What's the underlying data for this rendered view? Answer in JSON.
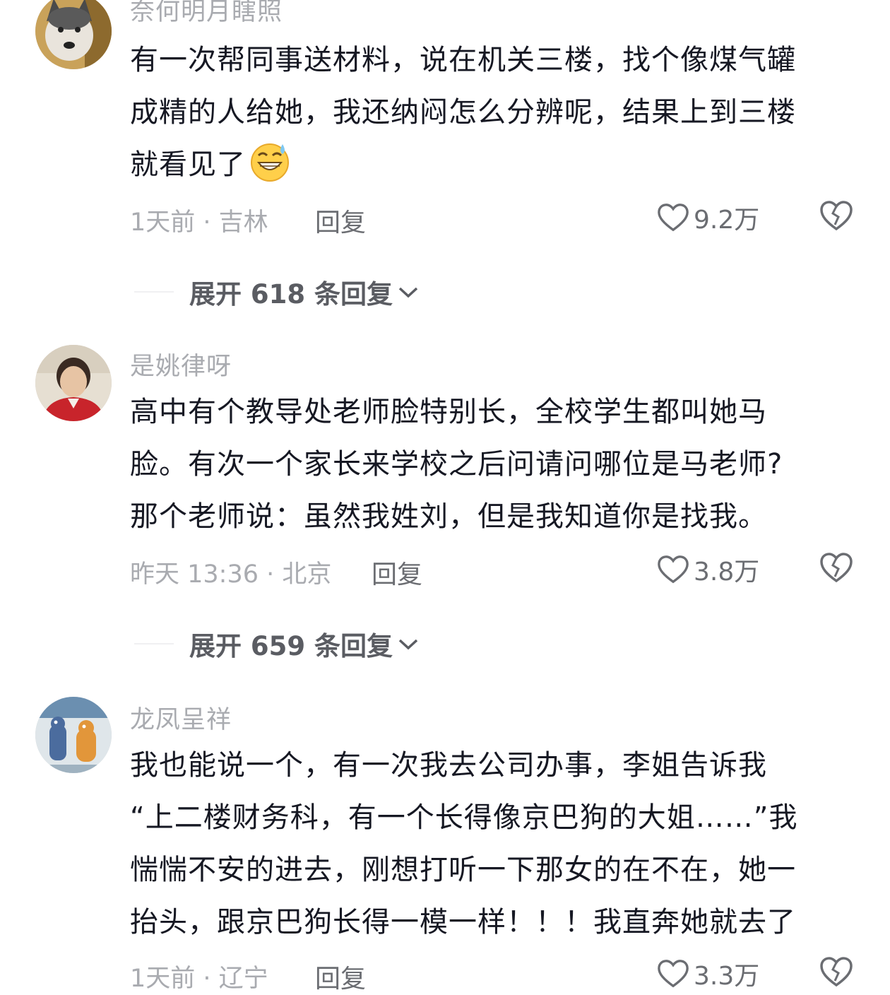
{
  "comments": [
    {
      "username": "奈何明月瞎照",
      "lines": [
        "有一次帮同事送材料，说在机关三楼，找个像煤气罐",
        "成精的人给她，我还纳闷怎么分辨呢，结果上到三楼",
        "就看见了"
      ],
      "emoji": "grinning-sweat-emoji",
      "meta": "1天前 · 吉林",
      "reply_label": "回复",
      "likes": "9.2万",
      "expand": "展开 618 条回复",
      "avatar": "husky-avatar"
    },
    {
      "username": "是姚律呀",
      "lines": [
        "高中有个教导处老师脸特别长，全校学生都叫她马",
        "脸。有次一个家长来学校之后问请问哪位是马老师?",
        "那个老师说：虽然我姓刘，但是我知道你是找我。"
      ],
      "meta": "昨天 13:36 · 北京",
      "reply_label": "回复",
      "likes": "3.8万",
      "expand": "展开 659 条回复",
      "avatar": "person-red-avatar"
    },
    {
      "username": "龙凤呈祥",
      "lines": [
        "我也能说一个，有一次我去公司办事，李姐告诉我",
        "“上二楼财务科，有一个长得像京巴狗的大姐……”我",
        "惴惴不安的进去，刚想打听一下那女的在不在，她一",
        "抬头，跟京巴狗长得一模一样！！！我直奔她就去了"
      ],
      "meta": "1天前 · 辽宁",
      "reply_label": "回复",
      "likes": "3.3万",
      "avatar": "cartoon-animals-avatar"
    }
  ],
  "colors": {
    "text": "#161823",
    "secondary": "#a9abb0",
    "action": "#6b6d72"
  }
}
